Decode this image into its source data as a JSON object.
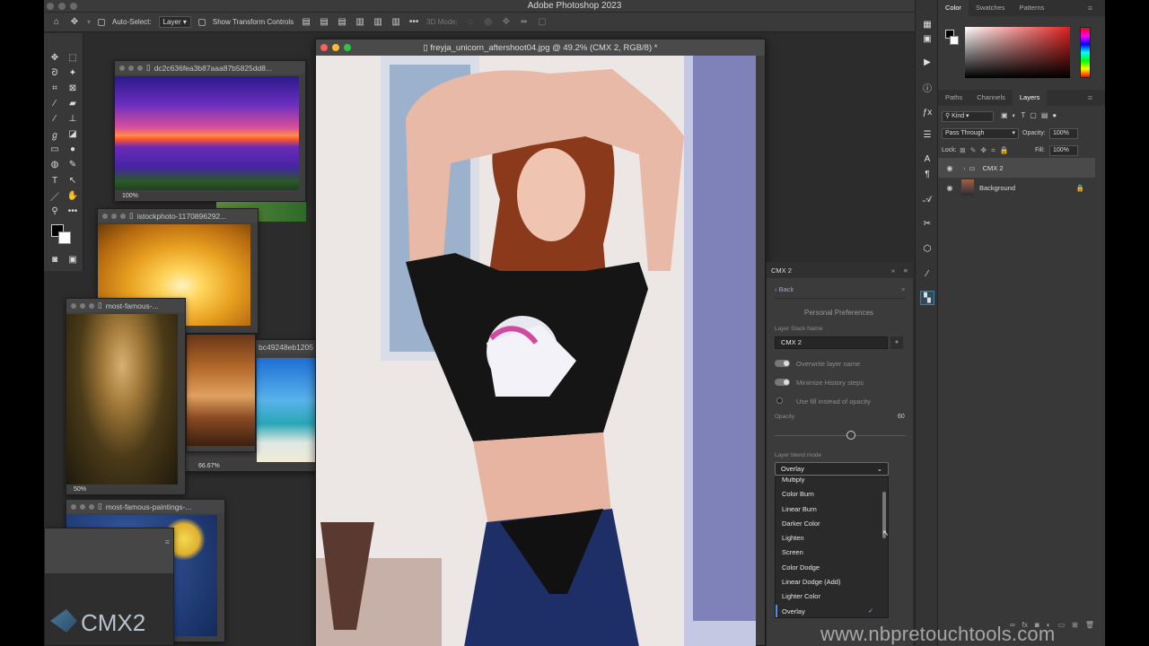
{
  "app": {
    "title": "Adobe Photoshop 2023"
  },
  "options": {
    "auto_select_label": "Auto-Select:",
    "auto_select_value": "Layer",
    "transform_controls_label": "Show Transform Controls",
    "mode_3d_label": "3D Mode:"
  },
  "docs": {
    "sunset": {
      "title": "dc2c636fea3b87aaa87b5825dd8...",
      "zoom": "100%"
    },
    "autumn": {
      "title": "istockphoto-1170896292..."
    },
    "beach": {
      "title": "bc49248eb1205"
    },
    "mona": {
      "title": "most-famous-...",
      "zoom": "50%"
    },
    "beach_zoom": "66.67%",
    "starry": {
      "title": "most-famous-paintings-..."
    }
  },
  "main_doc": {
    "title": "freyja_unicorn_aftershoot04.jpg @ 49.2% (CMX 2, RGB/8) *"
  },
  "color_panel": {
    "tabs": [
      "Color",
      "Swatches",
      "Patterns"
    ]
  },
  "layers_panel": {
    "tabs": [
      "Paths",
      "Channels",
      "Layers"
    ],
    "kind_label": "Kind",
    "blend_mode": "Pass Through",
    "opacity_label": "Opacity:",
    "opacity_value": "100%",
    "lock_label": "Lock:",
    "fill_label": "Fill:",
    "fill_value": "100%",
    "layers": [
      {
        "name": "CMX 2"
      },
      {
        "name": "Background"
      }
    ]
  },
  "cmx_panel": {
    "title": "CMX 2",
    "back_label": "Back",
    "section_title": "Personal Preferences",
    "stack_name_label": "Layer Stack Name",
    "stack_name_value": "CMX 2",
    "overwrite_label": "Overwrite layer name",
    "minimize_label": "Minimize History steps",
    "use_fill_label": "Use fill instead of opacity",
    "opacity_label": "Opacity",
    "opacity_value": "60",
    "blend_label": "Layer blend mode",
    "blend_value": "Overlay",
    "blend_options": [
      "Multiply",
      "Color Burn",
      "Linear Burn",
      "Darker Color",
      "Lighten",
      "Screen",
      "Color Dodge",
      "Linear Dodge (Add)",
      "Lighter Color",
      "Overlay"
    ]
  },
  "logo_text": "CMX2",
  "watermark": "www.nbpretouchtools.com",
  "colors": {
    "accent": "#4a8ef0",
    "panel": "#383838",
    "canvas": "#2c2c2c"
  }
}
